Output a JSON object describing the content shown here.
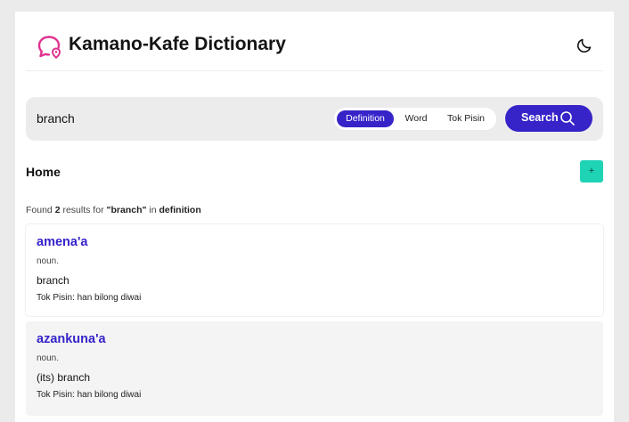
{
  "header": {
    "title": "Kamano-Kafe Dictionary",
    "logo_icon": "chat-bubble-location-icon",
    "theme_icon": "moon-icon",
    "accent_color": "#e0338f"
  },
  "search": {
    "query": "branch",
    "modes": [
      "Definition",
      "Word",
      "Tok Pisin"
    ],
    "active_mode": "Definition",
    "button_label": "Search",
    "button_icon": "search-icon",
    "button_color": "#3624c9"
  },
  "section": {
    "title": "Home",
    "add_label": "+",
    "add_color": "#1fd3b5"
  },
  "results": {
    "prefix": "Found",
    "count": "2",
    "middle": "results for",
    "query_quoted": "\"branch\"",
    "in_label": "in",
    "field": "definition",
    "entries": [
      {
        "word": "amena'a",
        "pos": "noun.",
        "definition": "branch",
        "tok_pisin": "Tok Pisin: han bilong diwai"
      },
      {
        "word": "azankuna'a",
        "pos": "noun.",
        "definition": "(its) branch",
        "tok_pisin": "Tok Pisin: han bilong diwai"
      }
    ]
  }
}
